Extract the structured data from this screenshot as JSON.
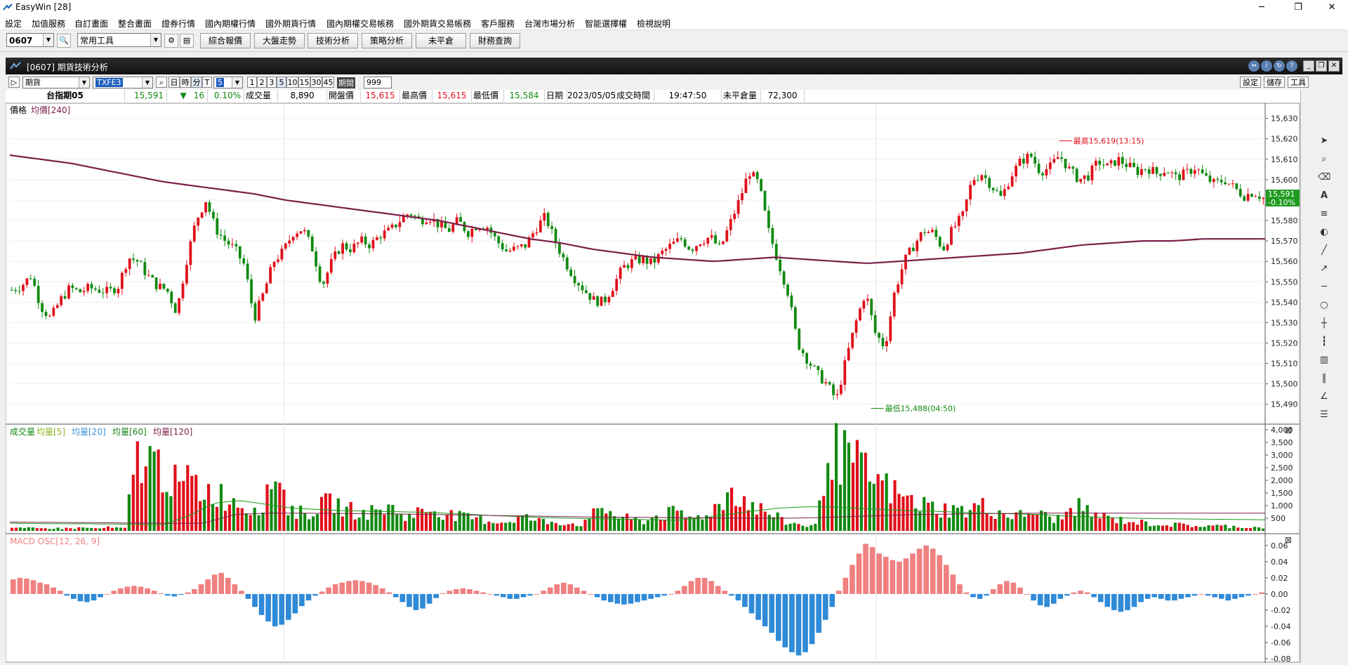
{
  "window": {
    "title": "EasyWin  [28]"
  },
  "menu": [
    "設定",
    "加值服務",
    "自訂畫面",
    "整合畫面",
    "證券行情",
    "國內期權行情",
    "國外期貨行情",
    "國內期權交易帳務",
    "國外期貨交易帳務",
    "客戶服務",
    "台灣市場分析",
    "智能選擇權",
    "檢視說明"
  ],
  "toolbar": {
    "symbol": "0607",
    "tool_select": "常用工具",
    "buttons": [
      "綜合報價",
      "大盤走勢",
      "技術分析",
      "策略分析",
      "未平倉",
      "財務查詢"
    ]
  },
  "child": {
    "title": "[0607] 期貨技術分析",
    "market_select": "期貨",
    "contract_select": "TXFE3",
    "period_buttons": [
      "日",
      "時",
      "分",
      "T"
    ],
    "minute_select": "5",
    "minute_buttons": [
      "1",
      "2",
      "3",
      "5",
      "10",
      "15",
      "30",
      "45"
    ],
    "period_label": "期間",
    "period_value": "999",
    "right_buttons": [
      "設定",
      "儲存",
      "工具"
    ]
  },
  "quote": {
    "name": "台指期05",
    "price": "15,591",
    "change": "16",
    "change_pct": "0.10%",
    "vol_label": "成交量",
    "vol": "8,890",
    "open_label": "開盤價",
    "open": "15,615",
    "high_label": "最高價",
    "high": "15,615",
    "low_label": "最低價",
    "low": "15,584",
    "date_label": "日期",
    "date": "2023/05/05",
    "time_label": "成交時間",
    "time": "19:47:50",
    "oi_label": "未平倉量",
    "oi": "72,300"
  },
  "colors": {
    "up": "#e0101a",
    "down": "#118a11",
    "ma": "#7b1f4a",
    "macd_pos": "#f08080",
    "macd_neg": "#2f8ad8"
  },
  "chart_data": [
    {
      "type": "candlestick",
      "legend": [
        "價格",
        "均價[240]"
      ],
      "yticks": [
        15490,
        15500,
        15510,
        15520,
        15530,
        15540,
        15550,
        15560,
        15570,
        15580,
        15590,
        15600,
        15610,
        15620,
        15630
      ],
      "ylim": [
        15482,
        15634
      ],
      "last_price_tag": "15,591",
      "last_change_tag": "-0.10%",
      "annotations": [
        {
          "text": "最高15,619(13:15)",
          "value": 15619
        },
        {
          "text": "最低15,488(04:50)",
          "value": 15488
        }
      ],
      "close_path": [
        15546,
        15548,
        15553,
        15538,
        15532,
        15541,
        15547,
        15545,
        15547,
        15546,
        15545,
        15548,
        15562,
        15560,
        15553,
        15548,
        15546,
        15535,
        15560,
        15580,
        15590,
        15576,
        15570,
        15566,
        15558,
        15532,
        15545,
        15560,
        15565,
        15574,
        15576,
        15566,
        15548,
        15560,
        15568,
        15566,
        15570,
        15568,
        15573,
        15575,
        15580,
        15584,
        15580,
        15582,
        15578,
        15575,
        15580,
        15574,
        15578,
        15577,
        15570,
        15565,
        15566,
        15568,
        15576,
        15582,
        15570,
        15560,
        15552,
        15546,
        15541,
        15540,
        15548,
        15557,
        15560,
        15561,
        15559,
        15564,
        15568,
        15571,
        15566,
        15570,
        15572,
        15566,
        15578,
        15590,
        15604,
        15598,
        15575,
        15560,
        15545,
        15520,
        15512,
        15505,
        15500,
        15492,
        15512,
        15530,
        15545,
        15525,
        15518,
        15545,
        15560,
        15568,
        15575,
        15574,
        15566,
        15576,
        15582,
        15600,
        15603,
        15597,
        15591,
        15602,
        15609,
        15612,
        15604,
        15606,
        15612,
        15605,
        15600,
        15602,
        15609,
        15606,
        15610,
        15607,
        15604,
        15606,
        15603,
        15605,
        15601,
        15603,
        15606,
        15601,
        15598,
        15600,
        15596,
        15592,
        15594,
        15591
      ],
      "ma240_path": [
        15612,
        15610,
        15608,
        15605,
        15602,
        15599,
        15597,
        15595,
        15593,
        15590,
        15588,
        15586,
        15584,
        15582,
        15580,
        15577,
        15574,
        15571,
        15569,
        15566,
        15564,
        15562,
        15561,
        15560,
        15561,
        15562,
        15561,
        15560,
        15559,
        15560,
        15561,
        15562,
        15563,
        15564,
        15566,
        15568,
        15569,
        15570,
        15570,
        15571,
        15571,
        15571
      ],
      "xlim": [
        0,
        129
      ]
    },
    {
      "type": "bar",
      "legend": [
        "成交量",
        "均量[5]",
        "均量[20]",
        "均量[60]",
        "均量[120]"
      ],
      "yticks": [
        500,
        1000,
        1500,
        2000,
        2500,
        3000,
        3500,
        4000
      ],
      "ylim": [
        0,
        4000
      ],
      "values": [
        120,
        100,
        110,
        90,
        130,
        100,
        110,
        120,
        130,
        90,
        140,
        120,
        100,
        3000,
        3100,
        2800,
        2600,
        2000,
        1800,
        2200,
        1600,
        1700,
        1500,
        1300,
        1200,
        900,
        1100,
        1400,
        2900,
        1000,
        800,
        700,
        900,
        1100,
        1200,
        900,
        850,
        700,
        800,
        900,
        950,
        700,
        600,
        800,
        900,
        850,
        700,
        600,
        550,
        500,
        450,
        400,
        350,
        500,
        600,
        450,
        400,
        380,
        350,
        300,
        280,
        420,
        1100,
        800,
        600,
        500,
        450,
        400,
        650,
        700,
        750,
        600,
        500,
        700,
        900,
        1200,
        1800,
        1400,
        1100,
        900,
        700,
        500,
        300,
        300,
        200,
        250,
        3600,
        3200,
        3000,
        2800,
        2400,
        2100,
        1900,
        1600,
        1400,
        1200,
        1100,
        1000,
        900,
        900,
        850,
        800,
        1100,
        900,
        800,
        700,
        600,
        700,
        800,
        600,
        500,
        550,
        1050,
        900,
        700,
        600,
        500,
        450,
        400,
        350,
        300,
        300,
        250,
        250,
        250,
        200,
        200,
        200,
        200,
        180,
        160,
        150,
        150
      ],
      "ma20_path": [
        300,
        290,
        280,
        280,
        270,
        260,
        250,
        600,
        1100,
        1200,
        1050,
        900,
        850,
        800,
        780,
        760,
        740,
        700,
        650,
        600,
        560,
        520,
        500,
        480,
        460,
        440,
        420,
        500,
        650,
        780,
        900,
        950,
        950,
        900,
        850,
        800,
        780,
        740,
        700,
        680,
        650,
        600,
        560,
        520,
        500,
        480,
        470,
        460,
        450,
        440
      ],
      "ma120_path": [
        350,
        340,
        330,
        320,
        310,
        300,
        300,
        650,
        700,
        700,
        690,
        680,
        670,
        650,
        630,
        610,
        590,
        570,
        550,
        540,
        530,
        520,
        510,
        500,
        500,
        520,
        560,
        600,
        640,
        660,
        680,
        690,
        700,
        700,
        700,
        700,
        700,
        700,
        700,
        700
      ]
    },
    {
      "type": "bar",
      "legend": [
        "MACD OSC[12, 26, 9]"
      ],
      "yticks": [
        -0.08,
        -0.06,
        -0.04,
        -0.02,
        0.0,
        0.02,
        0.04,
        0.06
      ],
      "ylim": [
        -0.08,
        0.065
      ],
      "values": [
        0.018,
        0.02,
        0.019,
        0.017,
        0.014,
        0.012,
        0.008,
        0.004,
        -0.002,
        -0.006,
        -0.009,
        -0.01,
        -0.008,
        -0.004,
        0.0,
        0.004,
        0.007,
        0.009,
        0.01,
        0.009,
        0.007,
        0.004,
        0.001,
        -0.002,
        -0.003,
        -0.001,
        0.002,
        0.006,
        0.012,
        0.018,
        0.024,
        0.026,
        0.02,
        0.012,
        0.004,
        -0.006,
        -0.016,
        -0.026,
        -0.034,
        -0.04,
        -0.038,
        -0.032,
        -0.024,
        -0.015,
        -0.008,
        -0.002,
        0.003,
        0.008,
        0.012,
        0.014,
        0.016,
        0.017,
        0.016,
        0.014,
        0.011,
        0.007,
        0.002,
        -0.004,
        -0.01,
        -0.016,
        -0.02,
        -0.018,
        -0.012,
        -0.005,
        0.001,
        0.004,
        0.006,
        0.007,
        0.006,
        0.004,
        0.002,
        0.0,
        -0.002,
        -0.004,
        -0.006,
        -0.006,
        -0.004,
        -0.002,
        0.0,
        0.004,
        0.008,
        0.012,
        0.014,
        0.012,
        0.008,
        0.004,
        0.0,
        -0.004,
        -0.008,
        -0.01,
        -0.012,
        -0.013,
        -0.012,
        -0.01,
        -0.008,
        -0.006,
        -0.004,
        -0.002,
        0.0,
        0.004,
        0.01,
        0.016,
        0.02,
        0.02,
        0.016,
        0.01,
        0.004,
        -0.002,
        -0.008,
        -0.016,
        -0.024,
        -0.032,
        -0.04,
        -0.048,
        -0.058,
        -0.066,
        -0.072,
        -0.076,
        -0.072,
        -0.062,
        -0.048,
        -0.032,
        -0.016,
        0.004,
        0.02,
        0.036,
        0.05,
        0.062,
        0.058,
        0.05,
        0.046,
        0.042,
        0.04,
        0.044,
        0.05,
        0.056,
        0.06,
        0.056,
        0.048,
        0.036,
        0.024,
        0.012,
        0.002,
        -0.004,
        -0.006,
        -0.002,
        0.006,
        0.012,
        0.016,
        0.014,
        0.008,
        0.0,
        -0.008,
        -0.014,
        -0.016,
        -0.012,
        -0.006,
        -0.002,
        0.002,
        0.004,
        0.002,
        -0.004,
        -0.01,
        -0.016,
        -0.02,
        -0.022,
        -0.02,
        -0.016,
        -0.01,
        -0.006,
        -0.004,
        -0.006,
        -0.008,
        -0.008,
        -0.006,
        -0.004,
        -0.002,
        0.0,
        -0.002,
        -0.004,
        -0.006,
        -0.008,
        -0.006,
        -0.004,
        -0.002,
        0.0,
        0.002
      ]
    }
  ]
}
